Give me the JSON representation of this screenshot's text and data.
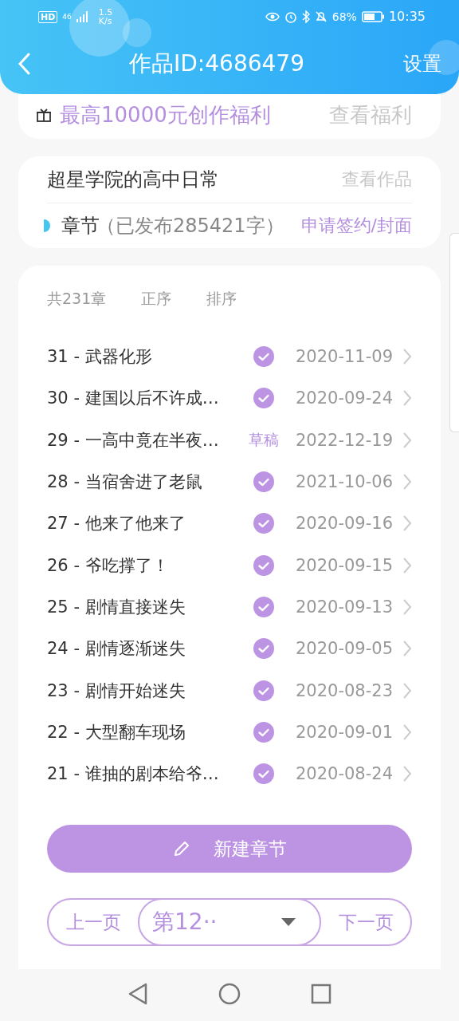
{
  "status_bar": {
    "hd": "HD",
    "network": "46",
    "speed": "1.5",
    "speed_unit": "K/s",
    "battery": "68%",
    "time": "10:35"
  },
  "header": {
    "title": "作品ID:4686479",
    "action": "设置"
  },
  "welfare": {
    "text": "最高10000元创作福利",
    "link": "查看福利"
  },
  "work": {
    "title": "超星学院的高中日常",
    "link": "查看作品",
    "chapters_label": "章节",
    "published": "（已发布285421字）",
    "apply": "申请签约/封面"
  },
  "list": {
    "count": "共231章",
    "sort_order": "正序",
    "sort": "排序",
    "chapters": [
      {
        "label": "31 - 武器化形",
        "kind": "published",
        "date": "2020-11-09"
      },
      {
        "label": "30 - 建国以后不许成…",
        "kind": "published",
        "date": "2020-09-24"
      },
      {
        "label": "29 - 一高中竟在半夜…",
        "kind": "draft",
        "status": "草稿",
        "date": "2022-12-19"
      },
      {
        "label": "28 - 当宿舍进了老鼠",
        "kind": "published",
        "date": "2021-10-06"
      },
      {
        "label": "27 - 他来了他来了",
        "kind": "published",
        "date": "2020-09-16"
      },
      {
        "label": "26 - 爷吃撑了！",
        "kind": "published",
        "date": "2020-09-15"
      },
      {
        "label": "25 - 剧情直接迷失",
        "kind": "published",
        "date": "2020-09-13"
      },
      {
        "label": "24 - 剧情逐渐迷失",
        "kind": "published",
        "date": "2020-09-05"
      },
      {
        "label": "23 - 剧情开始迷失",
        "kind": "published",
        "date": "2020-08-23"
      },
      {
        "label": "22 - 大型翻车现场",
        "kind": "published",
        "date": "2020-09-01"
      },
      {
        "label": "21 - 谁抽的剧本给爷…",
        "kind": "published",
        "date": "2020-08-24"
      }
    ],
    "new_button": "新建章节",
    "pager": {
      "prev": "上一页",
      "page": "第12··",
      "next": "下一页"
    }
  }
}
